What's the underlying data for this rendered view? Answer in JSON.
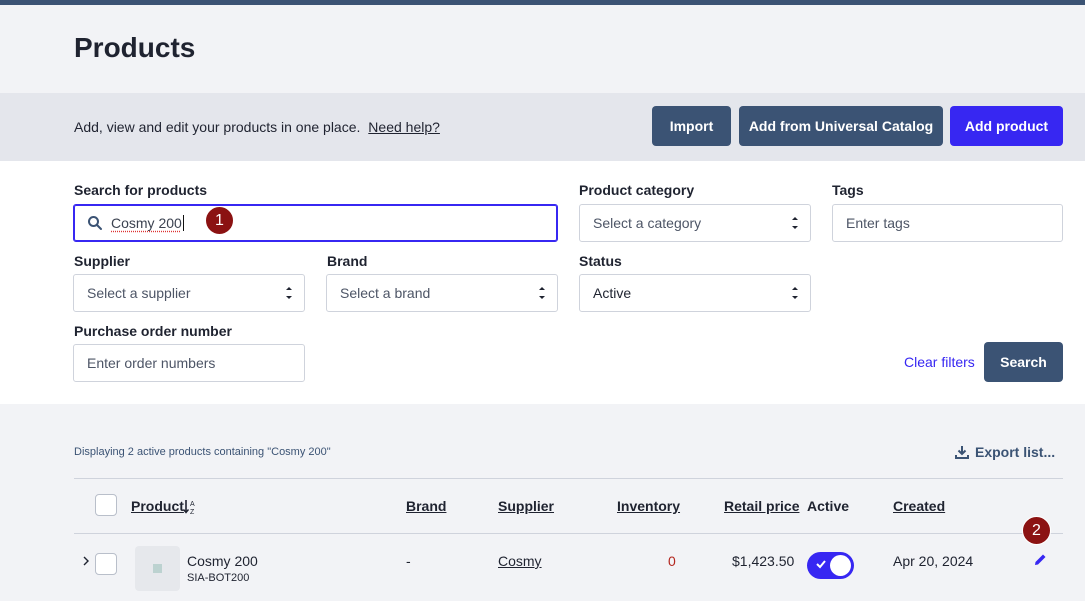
{
  "page": {
    "title": "Products"
  },
  "banner": {
    "text": "Add, view and edit your products in one place.",
    "help_link": "Need help?",
    "import_label": "Import",
    "universal_label": "Add from Universal Catalog",
    "add_label": "Add product"
  },
  "filters": {
    "search": {
      "label": "Search for products",
      "value": "Cosmy 200"
    },
    "category": {
      "label": "Product category",
      "placeholder": "Select a category"
    },
    "tags": {
      "label": "Tags",
      "placeholder": "Enter tags"
    },
    "supplier": {
      "label": "Supplier",
      "placeholder": "Select a supplier"
    },
    "brand": {
      "label": "Brand",
      "placeholder": "Select a brand"
    },
    "status": {
      "label": "Status",
      "value": "Active"
    },
    "po": {
      "label": "Purchase order number",
      "placeholder": "Enter order numbers"
    },
    "clear_label": "Clear filters",
    "search_button": "Search"
  },
  "annotations": {
    "one": "1",
    "two": "2"
  },
  "results": {
    "info": "Displaying 2 active products containing \"Cosmy 200\"",
    "export_label": "Export list..."
  },
  "table": {
    "headers": {
      "product": "Product",
      "brand": "Brand",
      "supplier": "Supplier",
      "inventory": "Inventory",
      "retail": "Retail price",
      "active": "Active",
      "created": "Created"
    },
    "rows": [
      {
        "name": "Cosmy 200",
        "sku": "SIA-BOT200",
        "brand": "-",
        "supplier": "Cosmy",
        "inventory": "0",
        "retail_price": "$1,423.50",
        "active": true,
        "created": "Apr 20, 2024"
      }
    ]
  },
  "colors": {
    "primary": "#3727f2",
    "navy": "#3b5374",
    "badge": "#8b1212",
    "inventory_zero": "#b3261e"
  }
}
